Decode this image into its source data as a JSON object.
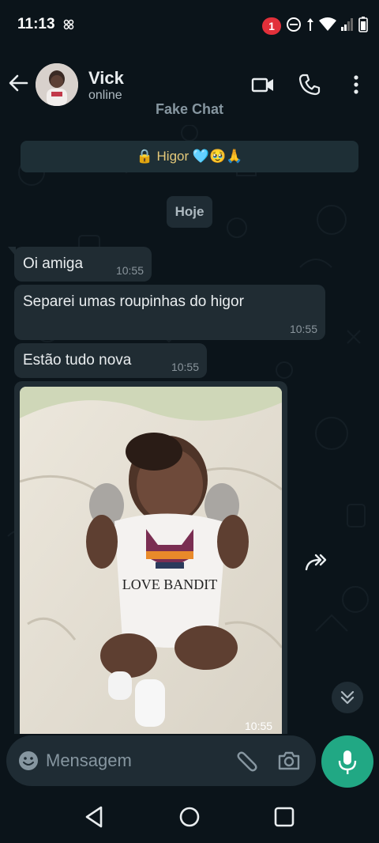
{
  "status_bar": {
    "time": "11:13",
    "notification_count": "1",
    "icons": [
      "settings-small-icon",
      "do-not-disturb-icon",
      "data-arrows-icon",
      "wifi-icon",
      "signal-icon",
      "battery-icon"
    ]
  },
  "header": {
    "contact_name": "Vick",
    "contact_status": "online",
    "watermark": "Fake Chat",
    "icons": [
      "back-arrow-icon",
      "video-call-icon",
      "phone-icon",
      "more-vertical-icon"
    ]
  },
  "chat": {
    "encryption_banner": "🔒 Higor 🩵🥹🙏",
    "date_chip": "Hoje",
    "messages": [
      {
        "text": "Oi amiga",
        "time": "10:55"
      },
      {
        "text": "Separei umas roupinhas do higor",
        "time": "10:55"
      },
      {
        "text": "Estão tudo nova",
        "time": "10:55"
      }
    ],
    "photo": {
      "onesie_text": "LOVE BANDIT",
      "time": "10:55"
    }
  },
  "composer": {
    "placeholder": "Mensagem",
    "icons": [
      "emoji-icon",
      "paperclip-icon",
      "camera-icon",
      "mic-icon"
    ]
  },
  "colors": {
    "background": "#0b141a",
    "bubble": "#202c33",
    "accent": "#21a884",
    "badge": "#e2303a"
  }
}
